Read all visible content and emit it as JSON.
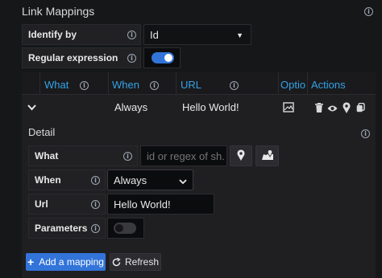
{
  "section": {
    "title": "Link Mappings"
  },
  "identify_by": {
    "label": "Identify by",
    "value": "Id"
  },
  "regex": {
    "label": "Regular expression",
    "enabled": true
  },
  "table": {
    "headers": [
      "What",
      "When",
      "URL",
      "Optio",
      "Actions"
    ],
    "row": {
      "when": "Always",
      "url": "Hello World!"
    }
  },
  "detail": {
    "title": "Detail",
    "what_label": "What",
    "what_placeholder": "id or regex of sh...",
    "when_label": "When",
    "when_value": "Always",
    "url_label": "Url",
    "url_value": "Hello World!",
    "params_label": "Parameters",
    "params_enabled": false
  },
  "buttons": {
    "add": "Add a mapping",
    "refresh": "Refresh"
  },
  "colors": {
    "accent": "#3274d9",
    "link": "#33a2e5",
    "background": "#161719"
  }
}
